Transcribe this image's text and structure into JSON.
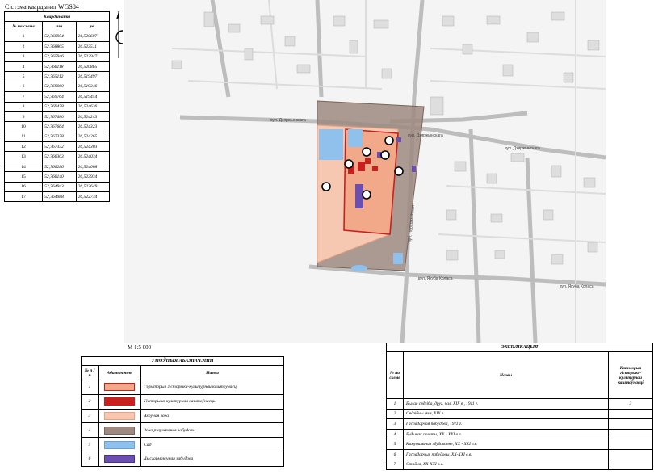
{
  "title": "Сістэма каардынат WGS84",
  "coords": {
    "caption": "Каардынаты",
    "headers": [
      "№ на схеме",
      "пш",
      "ув."
    ],
    "rows": [
      [
        "1",
        "52,768954",
        "26,520687"
      ],
      [
        "2",
        "52,768805",
        "26,523511"
      ],
      [
        "3",
        "52,765946",
        "26,522947"
      ],
      [
        "4",
        "52,766118",
        "26,520865"
      ],
      [
        "5",
        "52,765112",
        "26,519497"
      ],
      [
        "6",
        "52,769060",
        "26,519346"
      ],
      [
        "7",
        "52,769764",
        "26,519454"
      ],
      [
        "8",
        "52,769478",
        "26,524636"
      ],
      [
        "9",
        "52,767680",
        "26,524243"
      ],
      [
        "10",
        "52,767664",
        "26,524323"
      ],
      [
        "11",
        "52,767378",
        "26,524265"
      ],
      [
        "12",
        "52,767332",
        "26,524303"
      ],
      [
        "13",
        "52,766303",
        "26,524034"
      ],
      [
        "14",
        "52,766286",
        "26,524008"
      ],
      [
        "15",
        "52,766140",
        "26,523934"
      ],
      [
        "16",
        "52,764943",
        "26,523649"
      ],
      [
        "17",
        "52,764988",
        "26,522734"
      ]
    ]
  },
  "scale": "М 1:5 000",
  "map_labels": {
    "street_dzyarzhynskaga_1": "вул. Дзяржынскага",
    "street_dzyarzhynskaga_2": "вул. Дзяржынскага",
    "street_dzyarzhynskaga_3": "вул. Дзяржынскага",
    "street_yakuba_kolasa_1": "вул. Якуба Коласа",
    "street_yakuba_kolasa_2": "вул. Якуба Коласа",
    "street_pershamaiskaya": "вул. Першамайская"
  },
  "legend": {
    "caption": "УМОЎНЫЯ АБАЗНАЧЭННІ",
    "headers": [
      "№ п /п",
      "Абазначэнне",
      "Назвы"
    ],
    "rows": [
      {
        "n": "1",
        "label": "Тэрыторыя гісторыка-культурнай каштоўнасці",
        "color": "#f2a98a",
        "border": "#c8201d"
      },
      {
        "n": "2",
        "label": "Гісторыка-культурная каштоўнасць",
        "color": "#c8201d",
        "border": "#c8201d"
      },
      {
        "n": "3",
        "label": "Ахоўная зона",
        "color": "#f6c7b1",
        "border": "#e8a080"
      },
      {
        "n": "4",
        "label": "Зона рэгулявання забудовы",
        "color": "#9e8a80",
        "border": "#7a645a"
      },
      {
        "n": "5",
        "label": "Сад",
        "color": "#8fc1ec",
        "border": "#6aa0d8"
      },
      {
        "n": "6",
        "label": "Дысгарманічная забудова",
        "color": "#6a4fb0",
        "border": "#4a3290"
      }
    ]
  },
  "explication": {
    "caption": "ЭКСПЛІКАЦЫЯ",
    "headers": [
      "№ на схеме",
      "Назвы",
      "Катэгорыя гісторыка-культурнай каштоўнасці"
    ],
    "rows": [
      {
        "n": "1",
        "name": "Былая сядзіба, друг. пал. ХІХ в., 1911 г.",
        "cat": "3"
      },
      {
        "n": "2",
        "name": "Сядзібны дом, ХІХ в.",
        "cat": ""
      },
      {
        "n": "3",
        "name": "Гаспадарчая пабудова, 1911 г.",
        "cat": ""
      },
      {
        "n": "4",
        "name": "Будынак пошты, ХХ - ХХІ в.в.",
        "cat": ""
      },
      {
        "n": "5",
        "name": "Камунальныя збудаванне, ХХ - ХХІ в.в.",
        "cat": ""
      },
      {
        "n": "6",
        "name": "Гаспадарчыя пабудовы, ХХ-ХХІ в.в.",
        "cat": ""
      },
      {
        "n": "7",
        "name": "Стайня, ХХ-ХХІ в.в.",
        "cat": ""
      }
    ]
  }
}
